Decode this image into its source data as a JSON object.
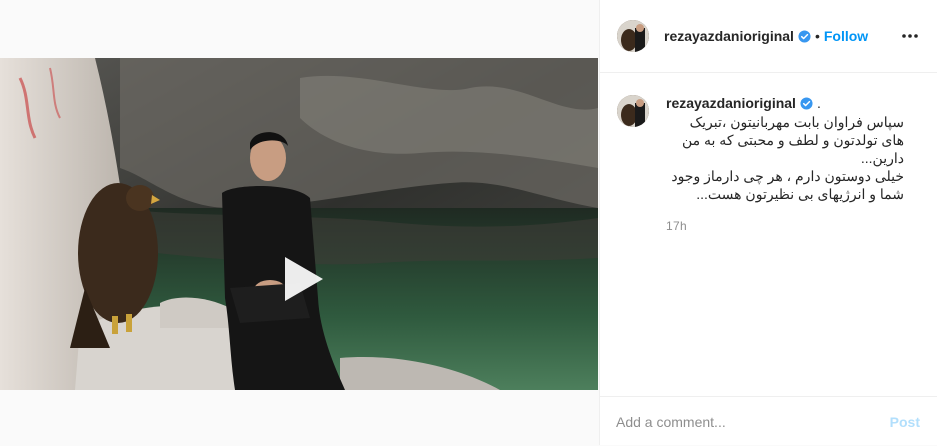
{
  "post": {
    "username": "rezayazdanioriginal",
    "verified": true,
    "follow_separator": "•",
    "follow_label": "Follow",
    "caption_suffix": ".",
    "caption": "سپاس فراوان بابت مهربانیتون ،تبریک های تولدتون و لطف و محبتی که به من دارین...\nخیلی دوستون دارم ، هر چی دارماز وجود شما و انرژیهای بی نظیرتون هست...",
    "timestamp": "17h"
  },
  "comment_bar": {
    "placeholder": "Add a comment...",
    "post_label": "Post"
  },
  "icons": {
    "play": "play-icon",
    "user_tag": "user-tag-icon",
    "verified": "verified-badge-icon",
    "more": "more-options-icon"
  },
  "colors": {
    "accent_blue": "#0095f6",
    "post_disabled": "#b2dffc",
    "muted_text": "#8e8e8e",
    "border": "#efefef"
  }
}
